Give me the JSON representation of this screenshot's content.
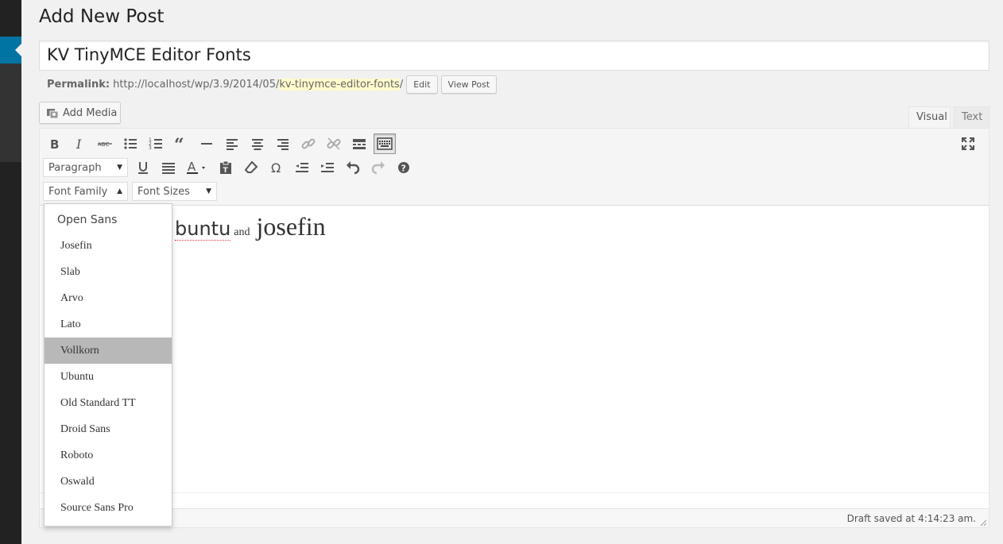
{
  "page": {
    "title": "Add New Post"
  },
  "post": {
    "title": "KV TinyMCE Editor Fonts",
    "permalink_label": "Permalink:",
    "permalink_base": "http://localhost/wp/3.9/2014/05/",
    "permalink_slug": "kv-tinymce-editor-fonts",
    "permalink_suffix": "/",
    "edit_label": "Edit",
    "view_post_label": "View Post"
  },
  "media": {
    "add_media_label": "Add Media"
  },
  "editor_tabs": {
    "visual": "Visual",
    "text": "Text"
  },
  "toolbar": {
    "row1": [
      "bold-icon",
      "italic-icon",
      "strikethrough-icon",
      "bullet-list-icon",
      "numbered-list-icon",
      "blockquote-icon",
      "horizontal-rule-icon",
      "align-left-icon",
      "align-center-icon",
      "align-right-icon",
      "link-icon",
      "unlink-icon",
      "read-more-icon",
      "toolbar-toggle-icon"
    ],
    "row2_format": "Paragraph",
    "row2": [
      "underline-icon",
      "justify-icon",
      "text-color-icon",
      "paste-text-icon",
      "clear-format-icon",
      "special-char-icon",
      "outdent-icon",
      "indent-icon",
      "undo-icon",
      "redo-icon",
      "help-icon"
    ],
    "font_family_label": "Font Family",
    "font_sizes_label": "Font Sizes"
  },
  "content": {
    "word1": "buntu",
    "word2": "and",
    "word3": "josefin"
  },
  "font_dropdown": {
    "first": "Open Sans",
    "items": [
      "Josefin",
      "Slab",
      "Arvo",
      "Lato",
      "Vollkorn",
      "Ubuntu",
      "Old Standard TT",
      "Droid Sans",
      "Roboto",
      "Oswald",
      "Source Sans Pro"
    ],
    "highlighted": "Vollkorn"
  },
  "status": {
    "draft_saved": "Draft saved at 4:14:23 am."
  },
  "colors": {
    "accent": "#0074a2",
    "admin_bg": "#222222",
    "highlight": "#b8b8b8",
    "slug_bg": "#fffbcc"
  }
}
